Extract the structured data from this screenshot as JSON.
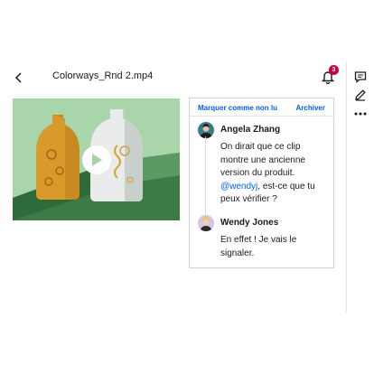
{
  "header": {
    "back_icon": "chevron-left-icon",
    "file_title": "Colorways_Rnd 2.mp4",
    "notification_count": "3",
    "notification_icon": "bell-icon"
  },
  "right_rail": [
    {
      "icon": "comment-icon"
    },
    {
      "icon": "pencil-icon"
    },
    {
      "icon": "more-icon"
    }
  ],
  "preview": {
    "play_icon": "play-icon",
    "background_color": "#a7d3a9"
  },
  "comments_panel": {
    "mark_unread_label": "Marquer comme non lu",
    "archive_label": "Archiver",
    "comments": [
      {
        "author": "Angela Zhang",
        "text_before": "On dirait que ce clip montre une ancienne version du produit. ",
        "mention": "@wendyj",
        "text_after": ", est-ce que tu peux vérifier ?"
      },
      {
        "author": "Wendy Jones",
        "text": "En effet ! Je vais le signaler."
      }
    ]
  },
  "colors": {
    "accent": "#0061fe",
    "badge": "#c5023e",
    "text": "#1e1919"
  }
}
